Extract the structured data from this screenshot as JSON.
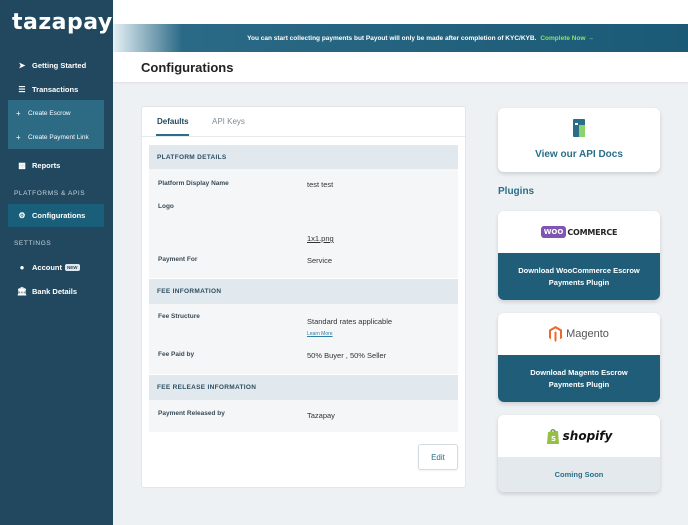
{
  "brand": {
    "logo_text": "tazapay"
  },
  "sidebar": {
    "items": [
      {
        "label": "Getting Started",
        "icon": "send-icon"
      },
      {
        "label": "Transactions",
        "icon": "list-icon"
      },
      {
        "label": "Reports",
        "icon": "report-icon"
      },
      {
        "label": "Configurations",
        "icon": "gear-icon"
      },
      {
        "label": "Account",
        "icon": "user-icon",
        "badge": "NEW"
      },
      {
        "label": "Bank Details",
        "icon": "bank-icon"
      }
    ],
    "sub_items": [
      {
        "label": "Create Escrow",
        "icon": "plus-icon"
      },
      {
        "label": "Create Payment Link",
        "icon": "plus-icon"
      }
    ],
    "sections": {
      "platforms": "PLATFORMS & APIS",
      "settings": "SETTINGS"
    }
  },
  "banner": {
    "message": "You can start collecting payments but Payout will only be made after completion of KYC/KYB.",
    "cta": "Complete Now"
  },
  "header": {
    "title": "Configurations"
  },
  "tabs": [
    "Defaults",
    "API Keys"
  ],
  "platform": {
    "heading": "PLATFORM DETAILS",
    "display_name_label": "Platform Display Name",
    "display_name_value": "test test",
    "logo_label": "Logo",
    "logo_file": "1x1.png",
    "payment_for_label": "Payment For",
    "payment_for_value": "Service"
  },
  "fee": {
    "heading": "FEE INFORMATION",
    "structure_label": "Fee Structure",
    "structure_value": "Standard rates applicable",
    "learn_more": "Learn More",
    "paid_by_label": "Fee Paid by",
    "paid_by_value": "50% Buyer , 50% Seller"
  },
  "release": {
    "heading": "FEE RELEASE INFORMATION",
    "released_by_label": "Payment Released by",
    "released_by_value": "Tazapay"
  },
  "edit_label": "Edit",
  "api_docs": {
    "label": "View our API Docs"
  },
  "plugins": {
    "title": "Plugins",
    "items": [
      {
        "logo_badge": "WOO",
        "logo_text": "COMMERCE",
        "action": "Download WooCommerce Escrow Payments Plugin"
      },
      {
        "logo_text": "Magento",
        "action": "Download Magento Escrow Payments Plugin"
      },
      {
        "logo_text": "shopify",
        "action": "Coming Soon"
      }
    ]
  },
  "colors": {
    "sidebar": "#22485f",
    "accent": "#2b6e8a",
    "cta_green": "#8fe06e",
    "woo_purple": "#7f54b3",
    "magento_orange": "#ee672f",
    "shopify_green": "#95bf47"
  }
}
